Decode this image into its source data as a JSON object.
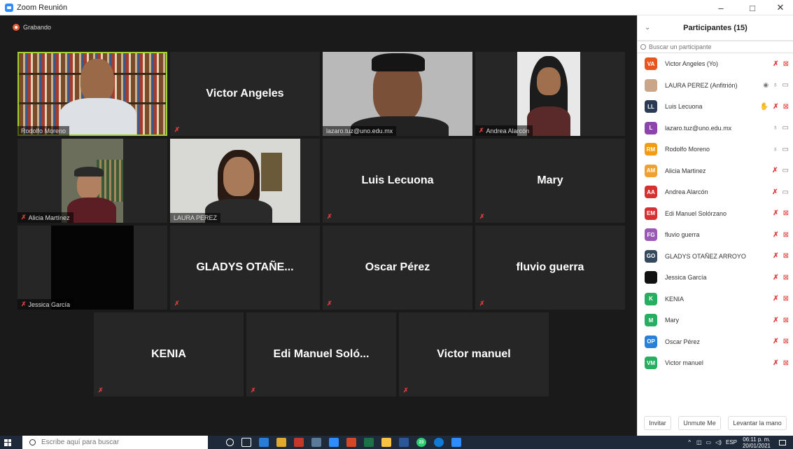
{
  "window": {
    "title": "Zoom Reunión",
    "minimize": "–",
    "maximize": "□",
    "close": "✕"
  },
  "recording_label": "Grabando",
  "tiles": [
    {
      "name": "",
      "label": "Rodolfo Moreno",
      "mic_muted": false,
      "video": true,
      "active": true
    },
    {
      "name": "Victor Angeles",
      "label": "",
      "mic_muted": true,
      "video": false
    },
    {
      "name": "",
      "label": "lazaro.tuz@uno.edu.mx",
      "mic_muted": false,
      "video": true
    },
    {
      "name": "",
      "label": "Andrea Alarcón",
      "mic_muted": true,
      "video": true
    },
    {
      "name": "",
      "label": "Alicia Martínez",
      "mic_muted": true,
      "video": true
    },
    {
      "name": "",
      "label": "LAURA PEREZ",
      "mic_muted": false,
      "video": true
    },
    {
      "name": "Luis Lecuona",
      "label": "",
      "mic_muted": true,
      "video": false
    },
    {
      "name": "Mary",
      "label": "",
      "mic_muted": true,
      "video": false
    },
    {
      "name": "",
      "label": "Jessica García",
      "mic_muted": true,
      "video": true
    },
    {
      "name": "GLADYS OTAÑE...",
      "label": "",
      "mic_muted": true,
      "video": false
    },
    {
      "name": "Oscar Pérez",
      "label": "",
      "mic_muted": true,
      "video": false
    },
    {
      "name": "fluvio guerra",
      "label": "",
      "mic_muted": true,
      "video": false
    },
    {
      "name": "KENIA",
      "label": "",
      "mic_muted": true,
      "video": false
    },
    {
      "name": "Edi Manuel Soló...",
      "label": "",
      "mic_muted": true,
      "video": false
    },
    {
      "name": "Victor manuel",
      "label": "",
      "mic_muted": true,
      "video": false
    }
  ],
  "panel": {
    "collapse_icon": "⌄",
    "title": "Participantes (15)",
    "search_placeholder": "Buscar un participante",
    "participants": [
      {
        "initials": "VA",
        "name": "Victor Angeles (Yo)",
        "color": "#e8551e",
        "icons": [
          "mic-muted",
          "cam-muted"
        ]
      },
      {
        "initials": "",
        "name": "LAURA PEREZ (Anfitrión)",
        "color": "#c9a58a",
        "icons": [
          "rec",
          "mic",
          "cam"
        ]
      },
      {
        "initials": "LL",
        "name": "Luis Lecuona",
        "color": "#2b3a55",
        "icons": [
          "hand",
          "mic-muted",
          "cam-muted"
        ]
      },
      {
        "initials": "L",
        "name": "lazaro.tuz@uno.edu.mx",
        "color": "#8e44ad",
        "icons": [
          "mic",
          "cam"
        ]
      },
      {
        "initials": "RM",
        "name": "Rodolfo Moreno",
        "color": "#f39c12",
        "icons": [
          "mic",
          "cam"
        ]
      },
      {
        "initials": "AM",
        "name": "Alicia Martinez",
        "color": "#f0a030",
        "icons": [
          "mic-muted",
          "cam"
        ]
      },
      {
        "initials": "AA",
        "name": "Andrea Alarcón",
        "color": "#d63031",
        "icons": [
          "mic-muted",
          "cam"
        ]
      },
      {
        "initials": "EM",
        "name": "Edi Manuel Solórzano",
        "color": "#d63031",
        "icons": [
          "mic-muted",
          "cam-muted"
        ]
      },
      {
        "initials": "FG",
        "name": "fluvio guerra",
        "color": "#9b59b6",
        "icons": [
          "mic-muted",
          "cam-muted"
        ]
      },
      {
        "initials": "GO",
        "name": "GLADYS OTAÑEZ ARROYO",
        "color": "#34495e",
        "icons": [
          "mic-muted",
          "cam-muted"
        ]
      },
      {
        "initials": "",
        "name": "Jessica García",
        "color": "#111111",
        "icons": [
          "mic-muted",
          "cam-muted"
        ]
      },
      {
        "initials": "K",
        "name": "KENIA",
        "color": "#27ae60",
        "icons": [
          "mic-muted",
          "cam-muted"
        ]
      },
      {
        "initials": "M",
        "name": "Mary",
        "color": "#27ae60",
        "icons": [
          "mic-muted",
          "cam-muted"
        ]
      },
      {
        "initials": "OP",
        "name": "Oscar Pérez",
        "color": "#2980d9",
        "icons": [
          "mic-muted",
          "cam-muted"
        ]
      },
      {
        "initials": "VM",
        "name": "Victor manuel",
        "color": "#27ae60",
        "icons": [
          "mic-muted",
          "cam-muted"
        ]
      }
    ],
    "buttons": {
      "invite": "Invitar",
      "unmute": "Unmute Me",
      "raise_hand": "Levantar la mano"
    }
  },
  "taskbar": {
    "search_placeholder": "Escribe aquí para buscar",
    "lang": "ESP",
    "time": "06:11 p. m.",
    "date": "20/01/2021",
    "whatsapp_badge": "23"
  }
}
